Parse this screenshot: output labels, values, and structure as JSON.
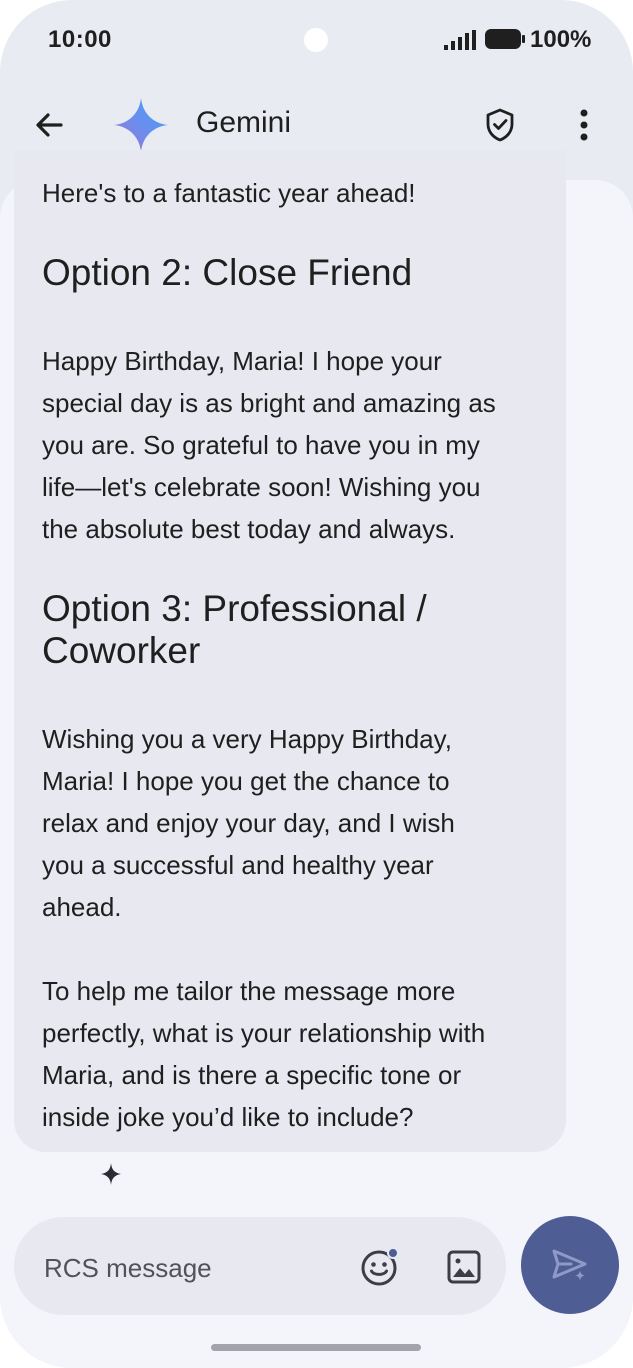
{
  "status_bar": {
    "time": "10:00",
    "battery": "100%",
    "icons": [
      "signal-icon",
      "battery-icon"
    ]
  },
  "app_bar": {
    "title": "Gemini",
    "icons": [
      "back-arrow-icon",
      "gemini-sparkle-icon",
      "shield-check-icon",
      "more-vert-icon"
    ]
  },
  "message": {
    "intro_tail": "Here's to a fantastic year ahead!",
    "option2_heading": "Option 2: Close Friend",
    "option2_lines": [
      "Happy Birthday, Maria! I hope your",
      "special day is as bright and amazing as",
      "you are. So grateful to have you in my",
      "life—let's celebrate soon! Wishing you",
      "the absolute best today and always."
    ],
    "option3_heading_lines": [
      "Option 3: Professional /",
      "Coworker"
    ],
    "option3_lines": [
      "Wishing you a very Happy Birthday,",
      "Maria! I hope you get the chance to",
      "relax and enjoy your day, and I wish",
      "you a successful and healthy year",
      "ahead."
    ],
    "followup_lines": [
      "To help me tailor the message more",
      "perfectly, what is your relationship with",
      "Maria, and is there a specific tone or",
      "inside joke you’d like to include?"
    ]
  },
  "compose": {
    "placeholder": "RCS message",
    "icons": [
      "emoji-icon",
      "image-icon",
      "send-icon"
    ]
  },
  "colors": {
    "background": "#e9ebf2",
    "chat_background": "#f4f5fb",
    "bubble": "#e8e8f0",
    "send_button": "#4e5d94",
    "text": "#1f1f1f"
  }
}
